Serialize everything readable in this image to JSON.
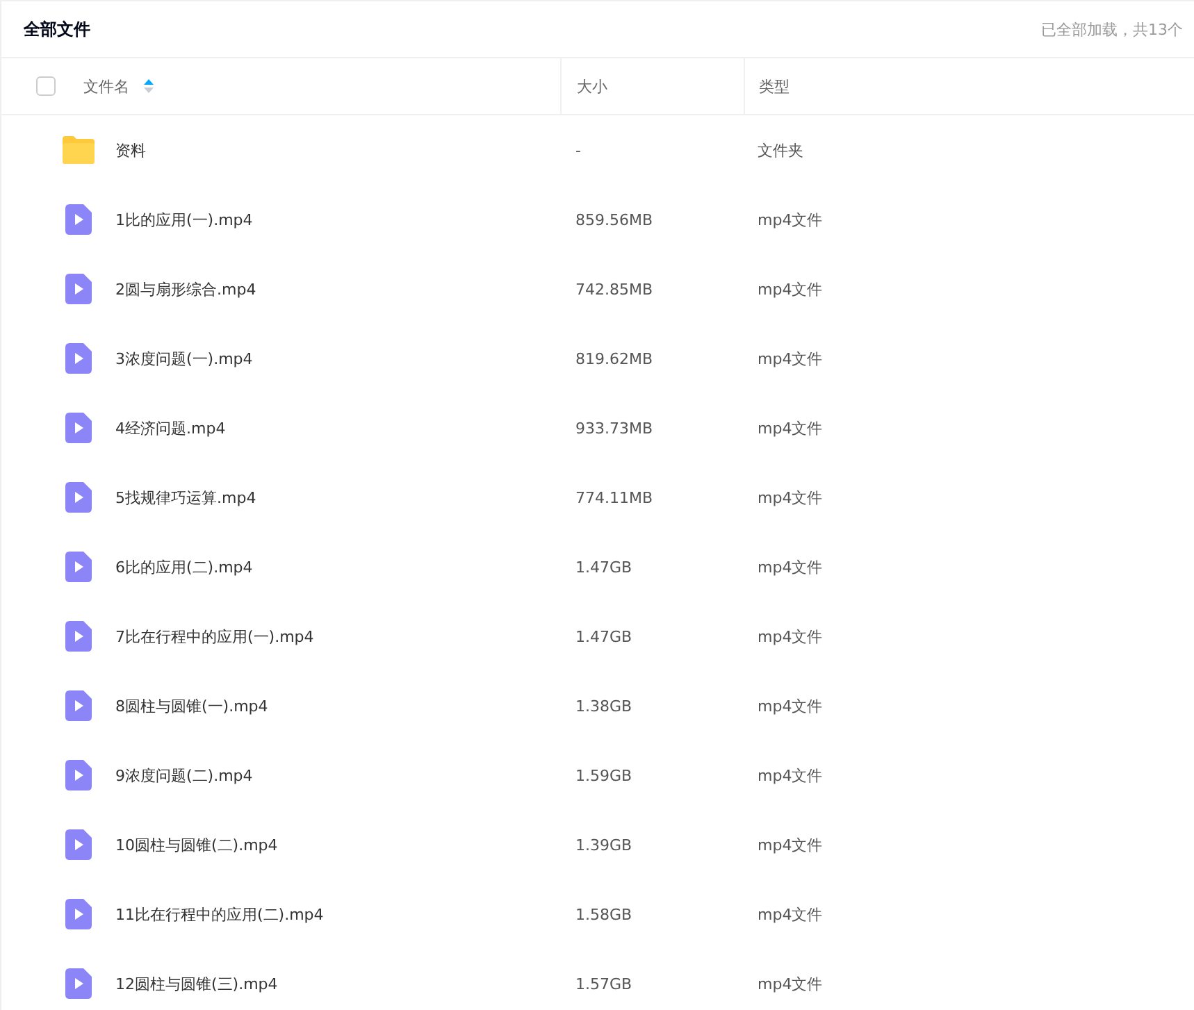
{
  "title": "全部文件",
  "status": "已全部加载，共13个",
  "table": {
    "select_all": {
      "checked": false
    },
    "columns": [
      "文件名",
      "大小",
      "类型"
    ],
    "rows": [
      {
        "kind": "folder",
        "name": "资料",
        "size": "-",
        "type": "文件夹"
      },
      {
        "kind": "video",
        "name": "1比的应用(一).mp4",
        "size": "859.56MB",
        "type": "mp4文件"
      },
      {
        "kind": "video",
        "name": "2圆与扇形综合.mp4",
        "size": "742.85MB",
        "type": "mp4文件"
      },
      {
        "kind": "video",
        "name": "3浓度问题(一).mp4",
        "size": "819.62MB",
        "type": "mp4文件"
      },
      {
        "kind": "video",
        "name": "4经济问题.mp4",
        "size": "933.73MB",
        "type": "mp4文件"
      },
      {
        "kind": "video",
        "name": "5找规律巧运算.mp4",
        "size": "774.11MB",
        "type": "mp4文件"
      },
      {
        "kind": "video",
        "name": "6比的应用(二).mp4",
        "size": "1.47GB",
        "type": "mp4文件"
      },
      {
        "kind": "video",
        "name": "7比在行程中的应用(一).mp4",
        "size": "1.47GB",
        "type": "mp4文件"
      },
      {
        "kind": "video",
        "name": "8圆柱与圆锥(一).mp4",
        "size": "1.38GB",
        "type": "mp4文件"
      },
      {
        "kind": "video",
        "name": "9浓度问题(二).mp4",
        "size": "1.59GB",
        "type": "mp4文件"
      },
      {
        "kind": "video",
        "name": "10圆柱与圆锥(二).mp4",
        "size": "1.39GB",
        "type": "mp4文件"
      },
      {
        "kind": "video",
        "name": "11比在行程中的应用(二).mp4",
        "size": "1.58GB",
        "type": "mp4文件"
      },
      {
        "kind": "video",
        "name": "12圆柱与圆锥(三).mp4",
        "size": "1.57GB",
        "type": "mp4文件"
      }
    ]
  }
}
